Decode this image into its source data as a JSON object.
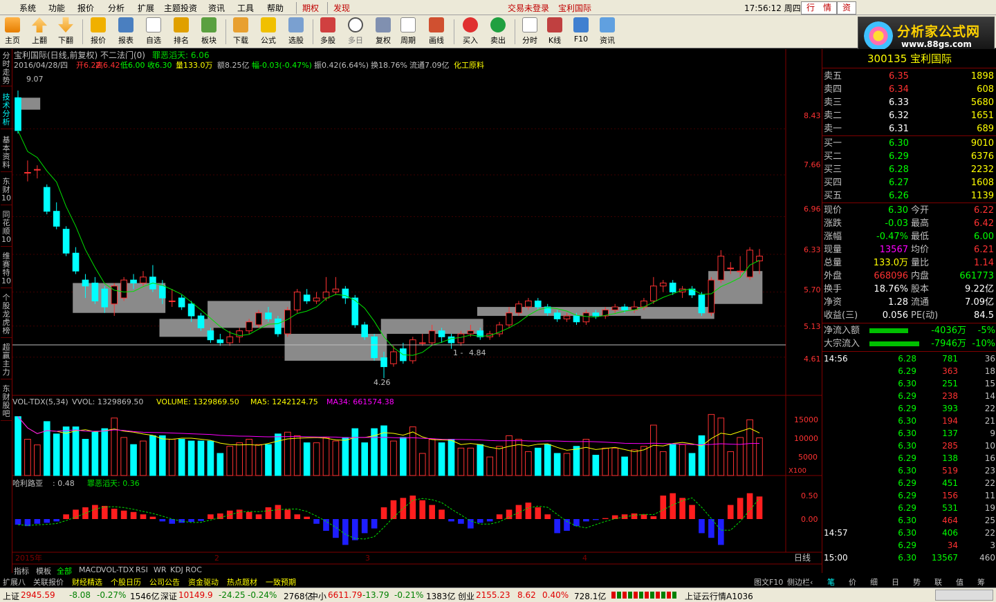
{
  "menu": {
    "items": [
      "系统",
      "功能",
      "报价",
      "分析",
      "扩展",
      "主题投资",
      "资讯",
      "工具",
      "帮助"
    ],
    "qiquan": "期权",
    "faxian": "发现",
    "login": "交易未登录",
    "stock_link": "宝利国际",
    "clock": "17:56:12 周四",
    "tab_quote": "行　情",
    "tab_trade": "资"
  },
  "toolbar": {
    "buttons": [
      "主页",
      "上翻",
      "下翻",
      "报价",
      "报表",
      "自选",
      "排名",
      "板块",
      "下载",
      "公式",
      "选股",
      "多股",
      "多日",
      "复权",
      "周期",
      "画线",
      "买入",
      "卖出",
      "分时",
      "K线",
      "F10",
      "资讯"
    ]
  },
  "logo": {
    "title": "分析家公式网",
    "url": "www.88gs.com"
  },
  "left_tabs": [
    "分时走势",
    "技术分析",
    "基本资料",
    "东财10",
    "同花顺10",
    "维赛特10",
    "个股龙虎榜",
    "超赢主力",
    "东财股吧"
  ],
  "chart_header": {
    "title": "宝利国际(日线,前复权) 不二法门(0)",
    "indicator": "罪恶滔天: 6.06",
    "date": "2016/04/28/四",
    "open": "开6.22",
    "high": "高6.42",
    "low": "低6.00",
    "close": "收6.30",
    "vol": "量133.0万",
    "amount": "额8.25亿",
    "change": "幅-0.03(-0.47%)",
    "amp": "振0.42(6.64%)",
    "turnover": "换18.76%",
    "float": "流通7.09亿",
    "industry": "化工原料"
  },
  "price_axis": [
    "8.43",
    "7.66",
    "6.96",
    "6.33",
    "5.70",
    "5.13",
    "4.61"
  ],
  "price_annotations": {
    "high": "9.07",
    "low": "4.26",
    "mid": "4.84",
    "mid_prefix": "1 -"
  },
  "vol_header": {
    "name": "VOL-TDX(5,34)",
    "vvol": "VVOL: 1329869.50",
    "volume": "VOLUME: 1329869.50",
    "ma5": "MA5: 1242124.75",
    "ma34": "MA34: 661574.38"
  },
  "vol_axis": [
    "15000",
    "10000",
    "5000"
  ],
  "vol_unit": "X100",
  "ind_header": {
    "name": "哈利路亚",
    "val": ": 0.48",
    "extra": "罪恶滔天: 0.36"
  },
  "ind_axis": [
    "0.50",
    "0.00"
  ],
  "date_axis": {
    "year": "2015年",
    "m2": "2",
    "m3": "3",
    "m4": "4",
    "period": "日线"
  },
  "chart_tabs": [
    "指标",
    "模板",
    "全部",
    "MACD",
    "VOL-TDX",
    "RSI",
    "WR",
    "KDJ",
    "ROC"
  ],
  "ext_tabs": [
    "扩展八",
    "关联报价",
    "财经精选",
    "个股日历",
    "公司公告",
    "资金驱动",
    "热点题材",
    "一致预期"
  ],
  "right_small_tabs": [
    "图文F10",
    "侧边栏‹"
  ],
  "quote": {
    "title": "300135 宝利国际",
    "asks": [
      {
        "l": "卖五",
        "p": "6.35",
        "v": "1898"
      },
      {
        "l": "卖四",
        "p": "6.34",
        "v": "608"
      },
      {
        "l": "卖三",
        "p": "6.33",
        "v": "5680"
      },
      {
        "l": "卖二",
        "p": "6.32",
        "v": "1651"
      },
      {
        "l": "卖一",
        "p": "6.31",
        "v": "689"
      }
    ],
    "bids": [
      {
        "l": "买一",
        "p": "6.30",
        "v": "9010"
      },
      {
        "l": "买二",
        "p": "6.29",
        "v": "6376"
      },
      {
        "l": "买三",
        "p": "6.28",
        "v": "2232"
      },
      {
        "l": "买四",
        "p": "6.27",
        "v": "1608"
      },
      {
        "l": "买五",
        "p": "6.26",
        "v": "1139"
      }
    ],
    "stats": [
      {
        "l": "现价",
        "v": "6.30",
        "l2": "今开",
        "v2": "6.22"
      },
      {
        "l": "涨跌",
        "v": "-0.03",
        "l2": "最高",
        "v2": "6.42"
      },
      {
        "l": "涨幅",
        "v": "-0.47%",
        "l2": "最低",
        "v2": "6.00"
      },
      {
        "l": "现量",
        "v": "13567",
        "l2": "均价",
        "v2": "6.21"
      },
      {
        "l": "总量",
        "v": "133.0万",
        "l2": "量比",
        "v2": "1.14"
      },
      {
        "l": "外盘",
        "v": "668096",
        "l2": "内盘",
        "v2": "661773"
      },
      {
        "l": "换手",
        "v": "18.76%",
        "l2": "股本",
        "v2": "9.22亿"
      },
      {
        "l": "净资",
        "v": "1.28",
        "l2": "流通",
        "v2": "7.09亿"
      },
      {
        "l": "收益(三)",
        "v": "0.056",
        "l2": "PE(动)",
        "v2": "84.5"
      }
    ],
    "flow": [
      {
        "l": "净流入额",
        "v": "-4036万",
        "pct": "-5%"
      },
      {
        "l": "大宗流入",
        "v": "-7946万",
        "pct": "-10%"
      }
    ],
    "ticks": [
      {
        "t": "14:56",
        "p": "6.28",
        "v": "781",
        "n": "36"
      },
      {
        "t": "",
        "p": "6.29",
        "v": "363",
        "n": "18"
      },
      {
        "t": "",
        "p": "6.30",
        "v": "251",
        "n": "15"
      },
      {
        "t": "",
        "p": "6.29",
        "v": "238",
        "n": "14"
      },
      {
        "t": "",
        "p": "6.29",
        "v": "393",
        "n": "22"
      },
      {
        "t": "",
        "p": "6.30",
        "v": "194",
        "n": "21"
      },
      {
        "t": "",
        "p": "6.30",
        "v": "137",
        "n": "9"
      },
      {
        "t": "",
        "p": "6.30",
        "v": "285",
        "n": "10"
      },
      {
        "t": "",
        "p": "6.29",
        "v": "138",
        "n": "16"
      },
      {
        "t": "",
        "p": "6.30",
        "v": "519",
        "n": "23"
      },
      {
        "t": "",
        "p": "6.29",
        "v": "451",
        "n": "22"
      },
      {
        "t": "",
        "p": "6.29",
        "v": "156",
        "n": "11"
      },
      {
        "t": "",
        "p": "6.29",
        "v": "531",
        "v2": "",
        "n": "19"
      },
      {
        "t": "",
        "p": "6.30",
        "v": "464",
        "n": "25"
      },
      {
        "t": "14:57",
        "p": "6.30",
        "v": "406",
        "n": "22"
      },
      {
        "t": "",
        "p": "6.29",
        "v": "34",
        "n": "3"
      },
      {
        "t": "15:00",
        "p": "6.30",
        "v": "13567",
        "n": "460"
      }
    ],
    "tabs": [
      "笔",
      "价",
      "细",
      "日",
      "势",
      "联",
      "值",
      "筹"
    ]
  },
  "status": {
    "sh_label": "上证",
    "sh": "2945.59",
    "sh_chg": "-8.08",
    "sh_pct": "-0.27%",
    "sh_amt": "1546亿",
    "sz_label": "深证",
    "sz": "10149.9",
    "sz_chg": "-24.25",
    "sz_pct": "-0.24%",
    "sz_amt": "2768亿",
    "zx_label": "中小",
    "zx": "6611.79",
    "zx_chg": "-13.79",
    "zx_pct": "-0.21%",
    "zx_amt": "1383亿",
    "cy_label": "创业",
    "cy": "2155.23",
    "cy_chg": "8.62",
    "cy_pct": "0.40%",
    "cy_amt": "728.1亿",
    "server": "上证云行情A1036"
  },
  "chart_data": {
    "type": "candlestick",
    "price_range": [
      4.26,
      9.07
    ],
    "candles": [
      [
        8.95,
        8.4,
        9.07,
        8.35
      ],
      [
        7.7,
        7.7,
        7.9,
        7.55
      ],
      [
        7.75,
        7.75,
        7.82,
        7.6
      ],
      [
        7.45,
        7.05,
        7.5,
        7.0
      ],
      [
        7.05,
        6.8,
        7.2,
        6.75
      ],
      [
        6.75,
        6.35,
        6.8,
        6.3
      ],
      [
        6.35,
        6.05,
        6.45,
        6.0
      ],
      [
        5.9,
        5.8,
        6.0,
        5.6
      ],
      [
        5.85,
        5.55,
        5.95,
        5.5
      ],
      [
        5.75,
        5.45,
        5.8,
        5.35
      ],
      [
        5.5,
        5.8,
        5.85,
        5.3
      ],
      [
        5.6,
        5.9,
        5.95,
        5.55
      ],
      [
        5.9,
        5.85,
        6.0,
        5.75
      ],
      [
        5.85,
        5.95,
        6.05,
        5.8
      ],
      [
        5.95,
        5.75,
        6.15,
        5.7
      ],
      [
        5.8,
        5.6,
        5.9,
        5.5
      ],
      [
        5.55,
        5.55,
        5.75,
        5.45
      ],
      [
        5.6,
        5.45,
        5.65,
        5.4
      ],
      [
        5.5,
        5.3,
        5.55,
        5.2
      ],
      [
        5.3,
        5.1,
        5.35,
        5.05
      ],
      [
        5.05,
        4.9,
        5.1,
        4.85
      ],
      [
        4.9,
        4.85,
        5.0,
        4.8
      ],
      [
        4.85,
        4.95,
        5.05,
        4.8
      ],
      [
        4.95,
        5.05,
        5.1,
        4.85
      ],
      [
        5.05,
        5.2,
        5.25,
        5.0
      ],
      [
        5.15,
        5.35,
        5.4,
        5.1
      ],
      [
        5.35,
        5.25,
        5.45,
        5.2
      ],
      [
        5.25,
        5.0,
        5.3,
        4.95
      ],
      [
        5.0,
        5.4,
        5.45,
        4.95
      ],
      [
        5.4,
        5.7,
        5.75,
        5.35
      ],
      [
        5.65,
        5.55,
        5.75,
        5.5
      ],
      [
        5.55,
        5.6,
        5.7,
        5.5
      ],
      [
        5.6,
        5.7,
        5.95,
        5.55
      ],
      [
        5.7,
        5.75,
        5.95,
        5.65
      ],
      [
        5.75,
        5.6,
        5.8,
        5.5
      ],
      [
        5.6,
        5.15,
        5.65,
        5.1
      ],
      [
        5.15,
        4.95,
        5.2,
        4.9
      ],
      [
        4.95,
        4.6,
        5.0,
        4.55
      ],
      [
        4.6,
        4.45,
        4.7,
        4.26
      ],
      [
        4.5,
        4.7,
        4.8,
        4.45
      ],
      [
        4.75,
        4.55,
        4.85,
        4.5
      ],
      [
        4.55,
        4.9,
        4.95,
        4.5
      ],
      [
        4.85,
        4.85,
        5.0,
        4.8
      ],
      [
        4.85,
        5.05,
        5.15,
        4.8
      ],
      [
        5.05,
        4.95,
        5.1,
        4.85
      ],
      [
        4.95,
        4.85,
        5.0,
        4.75
      ],
      [
        4.85,
        5.0,
        5.05,
        4.8
      ],
      [
        5.0,
        5.05,
        5.15,
        4.95
      ],
      [
        5.05,
        4.95,
        5.1,
        4.9
      ],
      [
        4.95,
        5.0,
        5.05,
        4.9
      ],
      [
        5.0,
        5.15,
        5.2,
        4.95
      ],
      [
        5.15,
        5.35,
        5.45,
        5.1
      ],
      [
        5.35,
        5.5,
        5.55,
        5.3
      ],
      [
        5.45,
        5.55,
        5.6,
        5.4
      ],
      [
        5.55,
        5.45,
        5.6,
        5.4
      ],
      [
        5.45,
        5.35,
        5.5,
        5.3
      ],
      [
        5.35,
        5.25,
        5.4,
        5.2
      ],
      [
        5.25,
        5.3,
        5.35,
        5.2
      ],
      [
        5.3,
        5.2,
        5.35,
        5.15
      ],
      [
        5.2,
        5.35,
        5.4,
        5.15
      ],
      [
        5.35,
        5.3,
        5.4,
        5.25
      ],
      [
        5.3,
        5.4,
        5.45,
        5.25
      ],
      [
        5.4,
        5.45,
        5.5,
        5.35
      ],
      [
        5.45,
        5.4,
        5.5,
        5.35
      ],
      [
        5.4,
        5.45,
        5.55,
        5.35
      ],
      [
        5.45,
        5.55,
        5.6,
        5.4
      ],
      [
        5.55,
        5.8,
        5.95,
        5.5
      ],
      [
        5.8,
        5.85,
        5.9,
        5.7
      ],
      [
        5.85,
        5.7,
        5.9,
        5.65
      ],
      [
        5.7,
        5.75,
        5.8,
        5.6
      ],
      [
        5.75,
        5.65,
        5.8,
        5.6
      ],
      [
        5.65,
        5.35,
        5.7,
        5.3
      ],
      [
        5.35,
        5.9,
        5.95,
        5.3
      ],
      [
        5.9,
        6.3,
        6.4,
        5.85
      ],
      [
        6.1,
        6.1,
        6.2,
        6.0
      ],
      [
        6.05,
        6.05,
        6.3,
        5.95
      ],
      [
        5.95,
        6.4,
        6.45,
        5.9
      ],
      [
        6.22,
        6.3,
        6.42,
        6.0
      ]
    ],
    "vol_ma_desc": "MA5 / MA34 overlays",
    "ind_values": [
      -0.12,
      -0.15,
      -0.1,
      -0.08,
      -0.05,
      0.1,
      0.2,
      0.25,
      0.3,
      0.28,
      0.22,
      0.18,
      0.15,
      0.1,
      0.05,
      -0.05,
      -0.1,
      -0.08,
      -0.06,
      -0.04,
      0.1,
      0.12,
      0.18,
      0.2,
      0.15,
      0.1,
      0.25,
      0.3,
      0.2,
      0.1,
      0.05,
      -0.1,
      -0.25,
      -0.4,
      -0.55,
      -0.45,
      -0.3,
      -0.2,
      0.25,
      0.4,
      0.45,
      0.5,
      0.4,
      0.3,
      0.2,
      -0.05,
      -0.1,
      -0.2,
      -0.08,
      -0.05,
      0.1,
      0.2,
      0.3,
      0.35,
      0.25,
      0.1,
      -0.3,
      -0.25,
      -0.15,
      -0.05,
      -0.02,
      0.02,
      0.08,
      0.1,
      0.12,
      0.1,
      0.06,
      0.5,
      0.55,
      0.45,
      0.3,
      -0.3,
      -0.4,
      -0.55,
      0.3,
      0.45,
      0.55,
      0.48
    ]
  }
}
